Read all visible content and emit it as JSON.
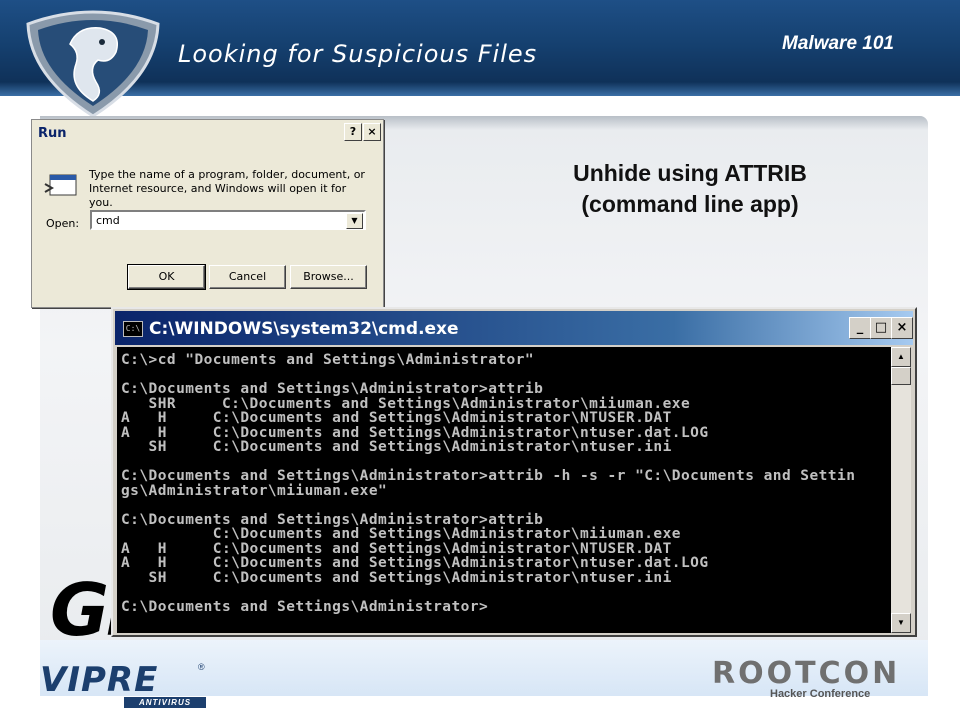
{
  "slide": {
    "title": "Looking for Suspicious Files",
    "tag": "Malware 101",
    "caption_line1": "Unhide using ATTRIB",
    "caption_line2": "(command line app)"
  },
  "run_dialog": {
    "title": "Run",
    "help_button": "?",
    "close_button": "×",
    "description_line1": "Type the name of a program, folder, document, or",
    "description_line2": "Internet resource, and Windows will open it for you.",
    "open_label": "Open:",
    "open_value": "cmd",
    "ok_label": "OK",
    "cancel_label": "Cancel",
    "browse_label": "Browse..."
  },
  "cmd_window": {
    "title": "C:\\WINDOWS\\system32\\cmd.exe",
    "minimize": "_",
    "maximize": "□",
    "close": "×",
    "lines": [
      "C:\\>cd \"Documents and Settings\\Administrator\"",
      "",
      "C:\\Documents and Settings\\Administrator>attrib",
      "   SHR     C:\\Documents and Settings\\Administrator\\miiuman.exe",
      "A   H     C:\\Documents and Settings\\Administrator\\NTUSER.DAT",
      "A   H     C:\\Documents and Settings\\Administrator\\ntuser.dat.LOG",
      "   SH     C:\\Documents and Settings\\Administrator\\ntuser.ini",
      "",
      "C:\\Documents and Settings\\Administrator>attrib -h -s -r \"C:\\Documents and Settin",
      "gs\\Administrator\\miiuman.exe\"",
      "",
      "C:\\Documents and Settings\\Administrator>attrib",
      "          C:\\Documents and Settings\\Administrator\\miiuman.exe",
      "A   H     C:\\Documents and Settings\\Administrator\\NTUSER.DAT",
      "A   H     C:\\Documents and Settings\\Administrator\\ntuser.dat.LOG",
      "   SH     C:\\Documents and Settings\\Administrator\\ntuser.ini",
      "",
      "C:\\Documents and Settings\\Administrator>"
    ]
  },
  "watermark": {
    "text": "GF"
  },
  "footer": {
    "vipre": "VIPRE",
    "vipre_reg": "®",
    "vipre_sub": "ANTIVIRUS",
    "rootcon": "ROOTCON",
    "rootcon_sub": "Hacker Conference"
  },
  "colors": {
    "header": "#15406f",
    "console_bg": "#000000",
    "console_text": "#c0c0c0",
    "titlebar": "#0a246a"
  },
  "icons": [
    "cobra-shield-logo",
    "run-dialog-icon",
    "cmd-icon",
    "scroll-up-icon",
    "scroll-down-icon"
  ]
}
